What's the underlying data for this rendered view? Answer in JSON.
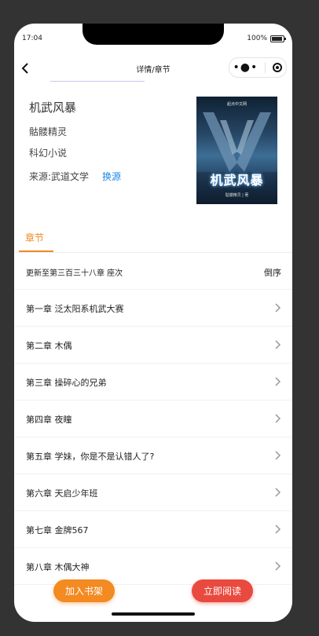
{
  "status_bar": {
    "time": "17:04",
    "battery": "100%"
  },
  "nav": {
    "title": "详情/章节"
  },
  "book": {
    "title": "机武风暴",
    "author": "骷髅精灵",
    "category": "科幻小说",
    "source": "来源:武道文学",
    "change_source_label": "换源",
    "cover": {
      "top_text": "起点中文网",
      "title": "机武风暴",
      "bottom_text": "骷髅精灵 | 著"
    }
  },
  "tabs": {
    "chapter_label": "章节"
  },
  "update": {
    "text": "更新至第三百三十八章 座次",
    "sort_label": "倒序"
  },
  "chapters": [
    {
      "title": "第一章 泛太阳系机武大赛"
    },
    {
      "title": "第二章 木偶"
    },
    {
      "title": "第三章 操碎心的兄弟"
    },
    {
      "title": "第四章 夜瞳"
    },
    {
      "title": "第五章 学妹，你是不是认错人了?"
    },
    {
      "title": "第六章 天启少年班"
    },
    {
      "title": "第七章 金牌567"
    },
    {
      "title": "第八章 木偶大神"
    }
  ],
  "actions": {
    "add_shelf_label": "加入书架",
    "read_now_label": "立即阅读"
  },
  "colors": {
    "accent": "#f08a24",
    "read_button": "#e94a3f",
    "link": "#1e88e5"
  }
}
